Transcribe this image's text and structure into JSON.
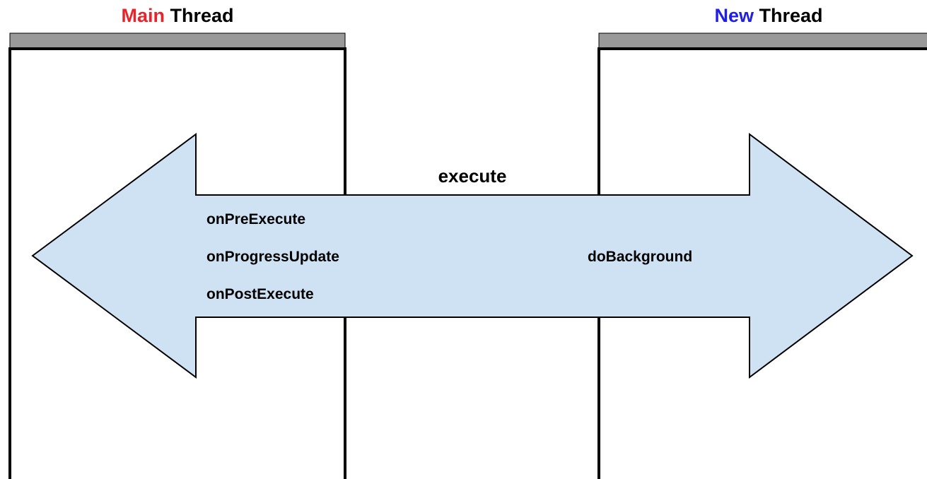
{
  "main_thread": {
    "title_word": "Main",
    "title_rest": " Thread",
    "word_color": "#e8232a"
  },
  "new_thread": {
    "title_word": "New",
    "title_rest": " Thread",
    "word_color": "#1f1fe6"
  },
  "arrow": {
    "label": "execute",
    "fill_color": "#cfe2f3"
  },
  "main_methods": [
    "onPreExecute",
    "onProgressUpdate",
    "onPostExecute"
  ],
  "new_methods": [
    "doBackground"
  ],
  "colors": {
    "header_bar": "#999999",
    "outline": "#000000"
  }
}
